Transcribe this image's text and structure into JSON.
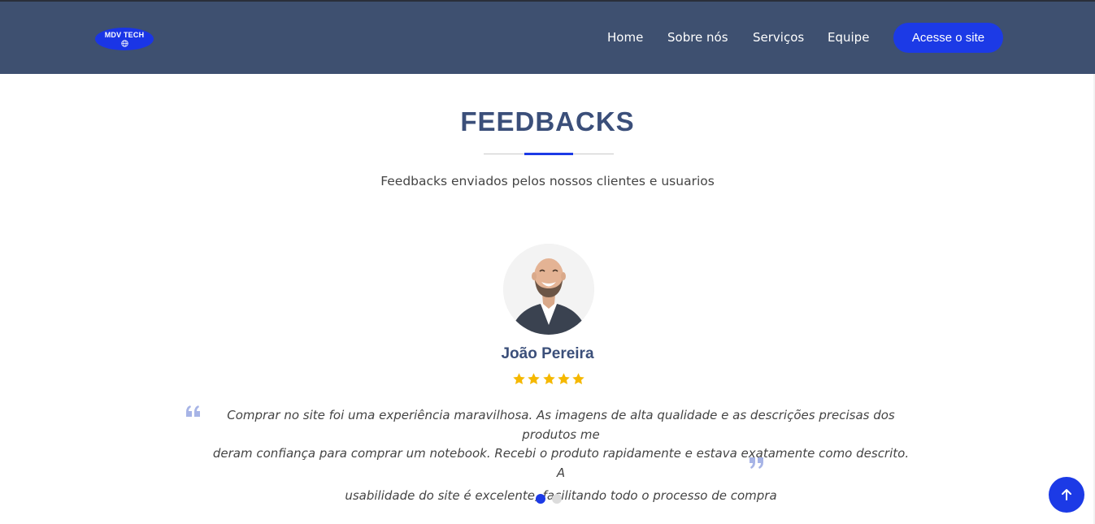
{
  "header": {
    "logo_text": "MDV TECH",
    "nav": [
      {
        "label": "Home"
      },
      {
        "label": "Sobre nós"
      },
      {
        "label": "Serviços"
      },
      {
        "label": "Equipe"
      }
    ],
    "cta_label": "Acesse o site",
    "background": "#3e5070",
    "accent": "#1c3ae6"
  },
  "section": {
    "title": "FEEDBACKS",
    "subtitle": "Feedbacks enviados pelos nossos clientes e usuarios"
  },
  "testimonial": {
    "name": "João Pereira",
    "rating": 5,
    "rating_max": 5,
    "quote_lines": [
      "Comprar no site foi uma experiência maravilhosa. As imagens de alta qualidade e as descrições precisas dos produtos me",
      "deram confiança para comprar um notebook. Recebi o produto rapidamente e estava exatamente como descrito. A",
      "usabilidade do site é excelente, facilitando todo o processo de compra"
    ]
  },
  "carousel": {
    "slides": 2,
    "active_index": 0,
    "active_color": "#1c3ae6",
    "inactive_color": "#dcdcdc"
  },
  "icons": {
    "back_to_top": "arrow-up-icon",
    "star": "star-icon",
    "open_quote": "open-quote-icon",
    "close_quote": "close-quote-icon"
  }
}
